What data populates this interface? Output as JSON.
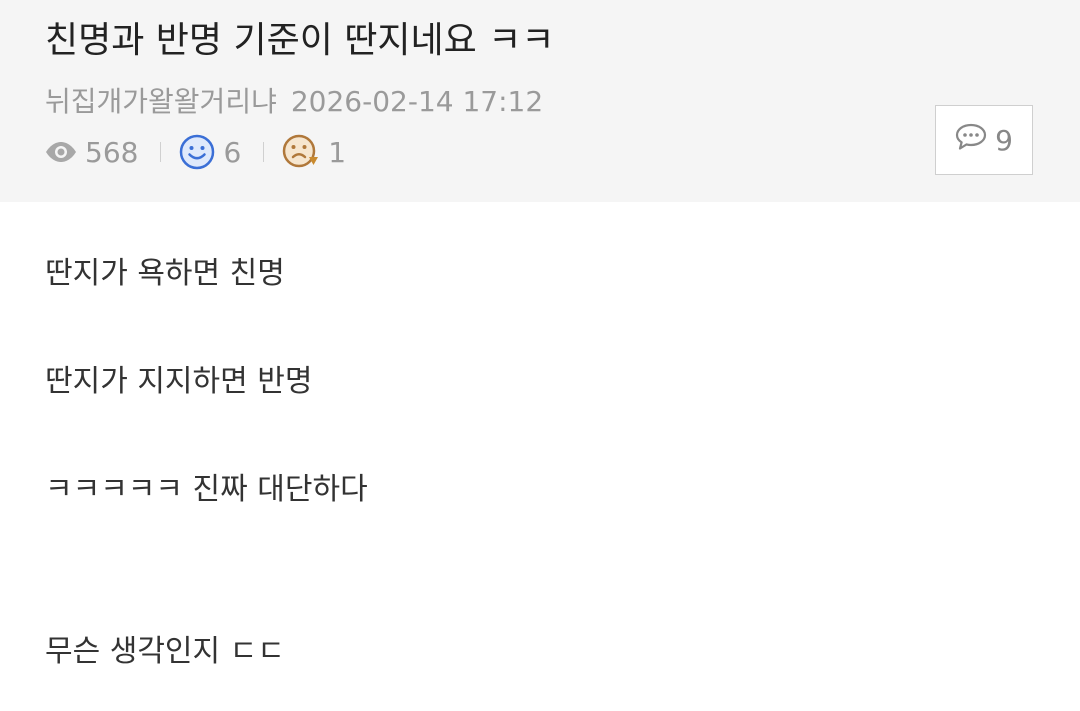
{
  "post": {
    "title": "친명과 반명 기준이 딴지네요 ㅋㅋ",
    "author": "뉘집개가왈왈거리냐",
    "datetime": "2026-02-14 17:12",
    "views": "568",
    "likes": "6",
    "dislikes": "1",
    "comment_count": "9"
  },
  "content": {
    "lines": [
      "딴지가 욕하면 친명",
      "딴지가 지지하면 반명",
      "ㅋㅋㅋㅋㅋ 진짜 대단하다",
      "무슨 생각인지 ㄷㄷ"
    ]
  },
  "icons": {
    "views": "eye-icon",
    "likes": "smile-icon",
    "dislikes": "frown-icon",
    "comments": "speech-bubble-icon"
  },
  "colors": {
    "header_bg": "#f5f5f5",
    "like_blue": "#3b6fd6",
    "dislike_brown": "#b0783a"
  }
}
